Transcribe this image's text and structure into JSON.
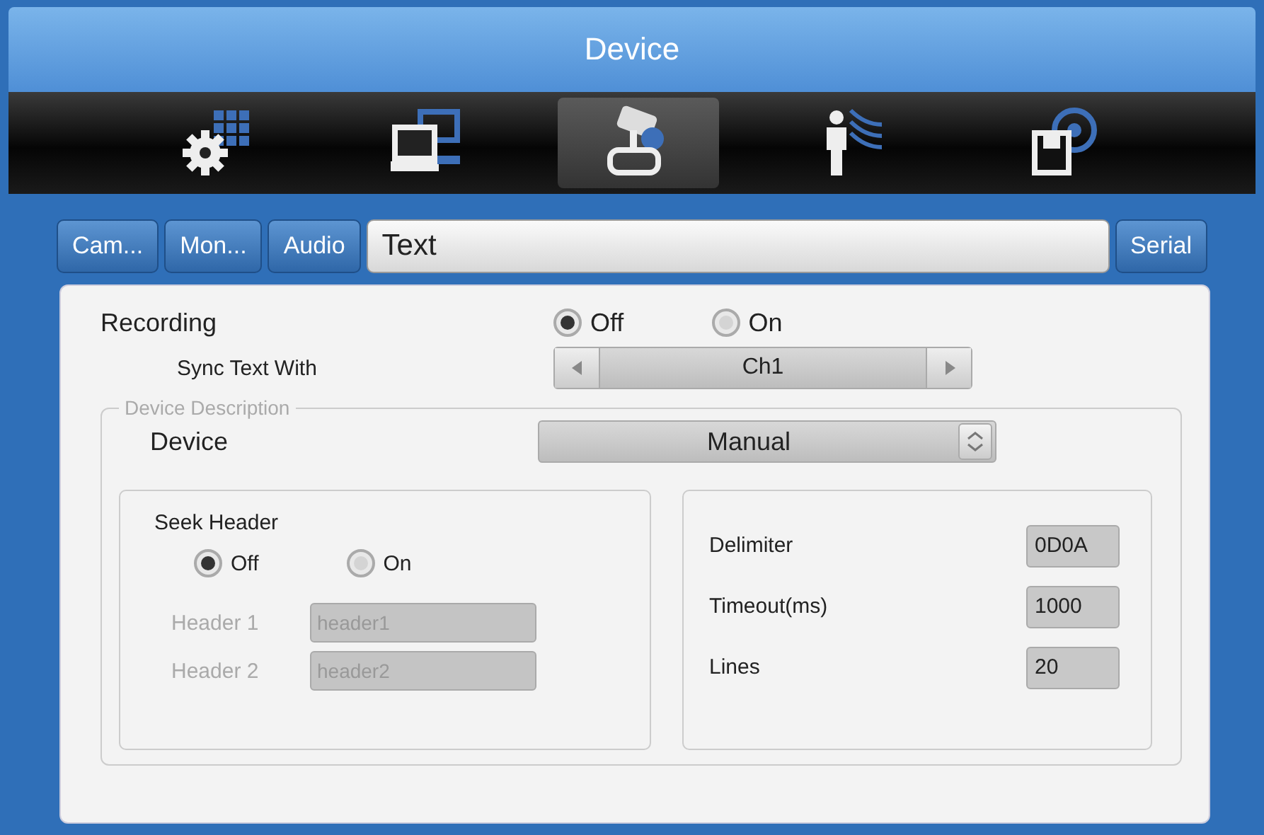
{
  "window": {
    "title": "Device"
  },
  "menu_icons": [
    {
      "kind": "settings",
      "selected": false
    },
    {
      "kind": "computers",
      "selected": false
    },
    {
      "kind": "joystick",
      "selected": true
    },
    {
      "kind": "person",
      "selected": false
    },
    {
      "kind": "disk",
      "selected": false
    }
  ],
  "tabs": [
    {
      "label": "Cam...",
      "selected": false
    },
    {
      "label": "Mon...",
      "selected": false
    },
    {
      "label": "Audio",
      "selected": false
    },
    {
      "label": "Text",
      "selected": true
    },
    {
      "label": "Serial",
      "selected": false
    }
  ],
  "recording": {
    "label": "Recording",
    "options": [
      {
        "label": "Off",
        "selected": true
      },
      {
        "label": "On",
        "selected": false
      }
    ]
  },
  "sync_text": {
    "label": "Sync Text With",
    "value": "Ch1"
  },
  "device_description": {
    "legend": "Device Description",
    "device": {
      "label": "Device",
      "value": "Manual"
    },
    "seek_header": {
      "label": "Seek Header",
      "options": [
        {
          "label": "Off",
          "selected": true
        },
        {
          "label": "On",
          "selected": false
        }
      ],
      "fields": [
        {
          "label": "Header 1",
          "value": "header1",
          "disabled": true
        },
        {
          "label": "Header 2",
          "value": "header2",
          "disabled": true
        }
      ]
    },
    "settings": [
      {
        "label": "Delimiter",
        "value": "0D0A"
      },
      {
        "label": "Timeout(ms)",
        "value": "1000"
      },
      {
        "label": "Lines",
        "value": "20"
      }
    ]
  }
}
